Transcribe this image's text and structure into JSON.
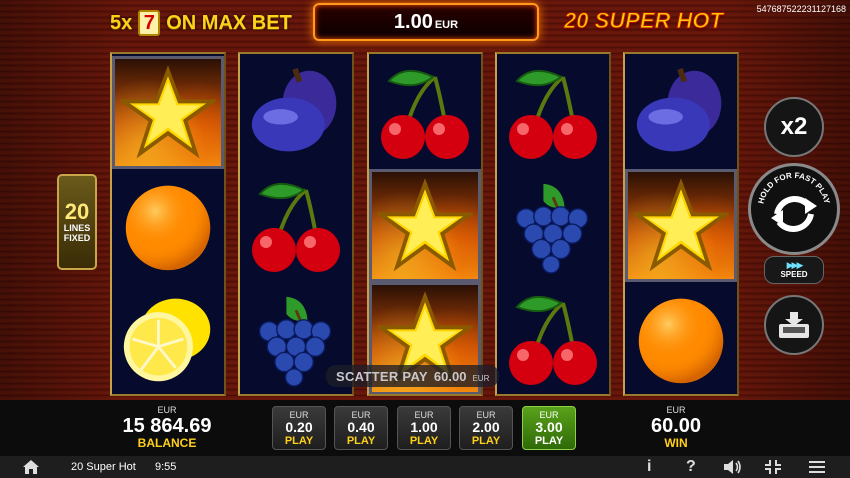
{
  "top": {
    "max_bet_multiplier": "5x",
    "max_bet_symbol": "7",
    "max_bet_text": "ON MAX BET",
    "bet_amount": "1.00",
    "bet_currency": "EUR",
    "game_title": "20 SUPER HOT",
    "ticket_id": "5476875222311271​68"
  },
  "lines_badge": {
    "number": "20",
    "line1": "LINES",
    "line2": "FIXED"
  },
  "reels": [
    [
      "star",
      "orange",
      "lemon"
    ],
    [
      "plum",
      "cherry",
      "grapes"
    ],
    [
      "cherry",
      "star",
      "star"
    ],
    [
      "cherry",
      "grapes",
      "cherry"
    ],
    [
      "plum",
      "star",
      "orange"
    ]
  ],
  "scatter": {
    "label": "SCATTER PAY",
    "value": "60.00",
    "currency": "EUR"
  },
  "controls": {
    "double_label": "x2",
    "spin_hint": "HOLD FOR FAST PLAY",
    "speed_label": "SPEED",
    "speed_arrows": "▶▶▶"
  },
  "balance": {
    "currency": "EUR",
    "value": "15 864.69",
    "label": "BALANCE"
  },
  "win": {
    "currency": "EUR",
    "value": "60.00",
    "label": "WIN"
  },
  "bet_buttons": [
    {
      "currency": "EUR",
      "value": "0.20",
      "label": "PLAY",
      "active": false
    },
    {
      "currency": "EUR",
      "value": "0.40",
      "label": "PLAY",
      "active": false
    },
    {
      "currency": "EUR",
      "value": "1.00",
      "label": "PLAY",
      "active": false
    },
    {
      "currency": "EUR",
      "value": "2.00",
      "label": "PLAY",
      "active": false
    },
    {
      "currency": "EUR",
      "value": "3.00",
      "label": "PLAY",
      "active": true
    }
  ],
  "footer": {
    "game_name": "20 Super Hot",
    "time": "9:55",
    "info_icon": "i",
    "help_icon": "?"
  },
  "colors": {
    "gold": "#ffd21a",
    "active_bet": "#5aa21a",
    "reel_bg": "#060a2c",
    "stage_red": "#5a1208"
  }
}
